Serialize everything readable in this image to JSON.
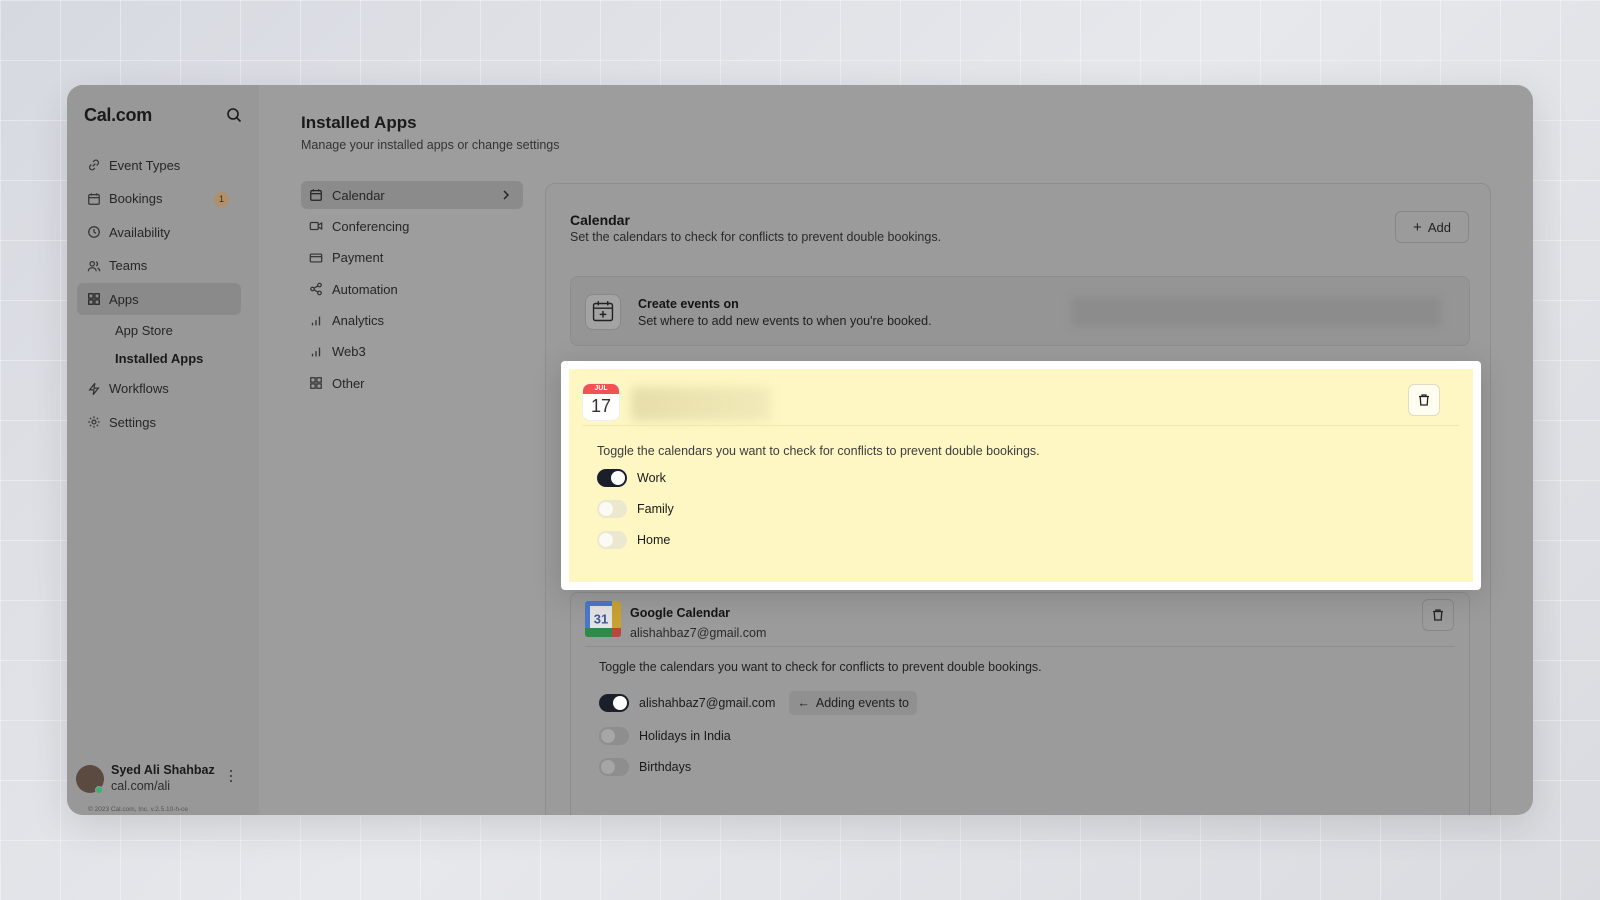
{
  "app": {
    "logo": "Cal.com",
    "copyright": "© 2023 Cal.com, Inc. v.2.5.10-h-ce"
  },
  "sidebar": {
    "items": [
      {
        "label": "Event Types",
        "icon": "link-icon"
      },
      {
        "label": "Bookings",
        "icon": "calendar-icon",
        "badge": "1"
      },
      {
        "label": "Availability",
        "icon": "clock-icon"
      },
      {
        "label": "Teams",
        "icon": "users-icon"
      },
      {
        "label": "Apps",
        "icon": "grid-icon",
        "active": true
      },
      {
        "label": "Workflows",
        "icon": "zap-icon"
      },
      {
        "label": "Settings",
        "icon": "gear-icon"
      }
    ],
    "apps_sub": [
      {
        "label": "App Store"
      },
      {
        "label": "Installed Apps",
        "active": true
      }
    ],
    "user": {
      "name": "Syed Ali Shahbaz",
      "handle": "cal.com/ali"
    }
  },
  "header": {
    "title": "Installed Apps",
    "subtitle": "Manage your installed apps or change settings"
  },
  "categories": [
    {
      "label": "Calendar",
      "icon": "calendar-icon",
      "active": true
    },
    {
      "label": "Conferencing",
      "icon": "video-icon"
    },
    {
      "label": "Payment",
      "icon": "credit-card-icon"
    },
    {
      "label": "Automation",
      "icon": "share-icon"
    },
    {
      "label": "Analytics",
      "icon": "bar-chart-icon"
    },
    {
      "label": "Web3",
      "icon": "bar-chart-icon"
    },
    {
      "label": "Other",
      "icon": "grid-icon"
    }
  ],
  "calendar_panel": {
    "title": "Calendar",
    "subtitle": "Set the calendars to check for conflicts to prevent double bookings.",
    "add_label": "Add",
    "create_events": {
      "title": "Create events on",
      "subtitle": "Set where to add new events to when you're booked."
    },
    "apple_calendar": {
      "icon_month": "JUL",
      "icon_day": "17",
      "description": "Toggle the calendars you want to check for conflicts to prevent double bookings.",
      "calendars": [
        {
          "label": "Work",
          "enabled": true
        },
        {
          "label": "Family",
          "enabled": false
        },
        {
          "label": "Home",
          "enabled": false
        }
      ]
    },
    "google_calendar": {
      "name": "Google Calendar",
      "email": "alishahbaz7@gmail.com",
      "icon_day": "31",
      "description": "Toggle the calendars you want to check for conflicts to prevent double bookings.",
      "calendars": [
        {
          "label": "alishahbaz7@gmail.com",
          "enabled": true,
          "tag": "Adding events to"
        },
        {
          "label": "Holidays in India",
          "enabled": false
        },
        {
          "label": "Birthdays",
          "enabled": false
        }
      ]
    }
  },
  "colors": {
    "highlight_bg": "#fef7c3",
    "toggle_on": "#1b1f2a",
    "online_dot": "#3bb36a",
    "apple_red": "#f25252"
  }
}
